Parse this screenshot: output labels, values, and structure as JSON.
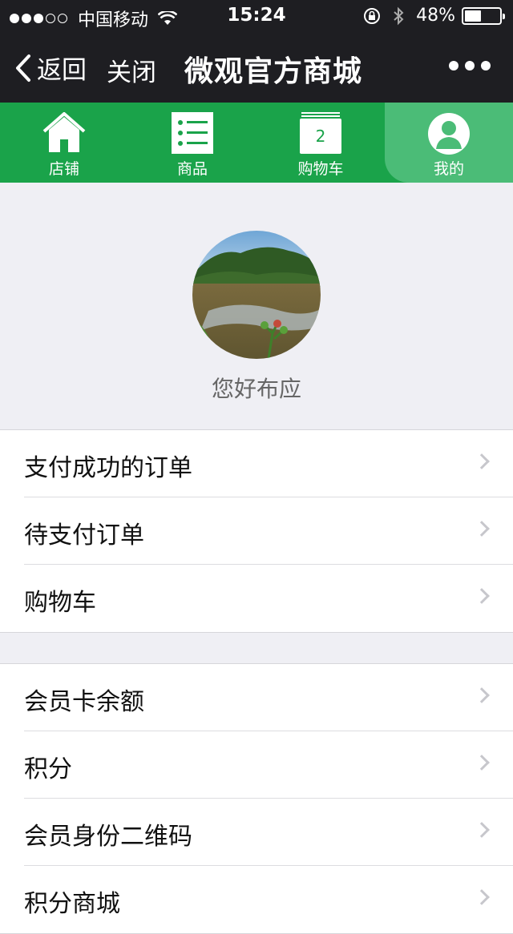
{
  "status_bar": {
    "signal_dots_filled": 3,
    "signal_dots_total": 5,
    "carrier": "中国移动",
    "wifi_icon": "wifi-icon",
    "time": "15:24",
    "rotation_lock_icon": "rotation-lock-icon",
    "bluetooth_icon": "bluetooth-icon",
    "battery_percent": "48%",
    "battery_level": 0.48
  },
  "nav": {
    "back_label": "返回",
    "close_label": "关闭",
    "title": "微观官方商城",
    "more_icon": "more-dots-icon"
  },
  "tabs": [
    {
      "label": "店铺",
      "icon": "home-icon",
      "active": false
    },
    {
      "label": "商品",
      "icon": "list-icon",
      "active": false
    },
    {
      "label": "购物车",
      "icon": "cart-icon",
      "badge": "2",
      "active": false
    },
    {
      "label": "我的",
      "icon": "user-icon",
      "active": true
    }
  ],
  "profile": {
    "username": "您好布应"
  },
  "menu_group_1": [
    {
      "label": "支付成功的订单"
    },
    {
      "label": "待支付订单"
    },
    {
      "label": "购物车"
    }
  ],
  "menu_group_2": [
    {
      "label": "会员卡余额"
    },
    {
      "label": "积分"
    },
    {
      "label": "会员身份二维码"
    },
    {
      "label": "积分商城"
    }
  ],
  "colors": {
    "bar_dark": "#1e1e22",
    "brand_green": "#1aa34a",
    "active_tab": "#4bbc77",
    "background": "#efeff4"
  }
}
